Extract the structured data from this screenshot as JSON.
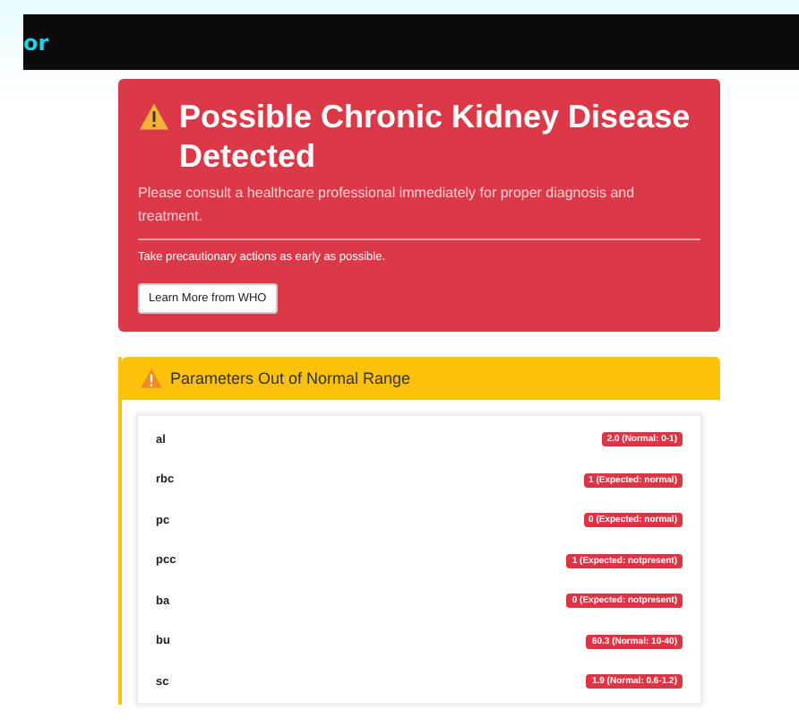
{
  "navbar": {
    "brand": "or"
  },
  "alert": {
    "title": "Possible Chronic Kidney Disease Detected",
    "message": "Please consult a healthcare professional immediately for proper diagnosis and treatment.",
    "note": "Take precautionary actions as early as possible.",
    "button": "Learn More from WHO"
  },
  "parameters": {
    "title": "Parameters Out of Normal Range",
    "rows": [
      {
        "name": "al",
        "value": "2.0 (Normal: 0-1)"
      },
      {
        "name": "rbc",
        "value": "1 (Expected: normal)"
      },
      {
        "name": "pc",
        "value": "0 (Expected: normal)"
      },
      {
        "name": "pcc",
        "value": "1 (Expected: notpresent)"
      },
      {
        "name": "ba",
        "value": "0 (Expected: notpresent)"
      },
      {
        "name": "bu",
        "value": "60.3 (Normal: 10-40)"
      },
      {
        "name": "sc",
        "value": "1.9 (Normal: 0.6-1.2)"
      }
    ]
  }
}
